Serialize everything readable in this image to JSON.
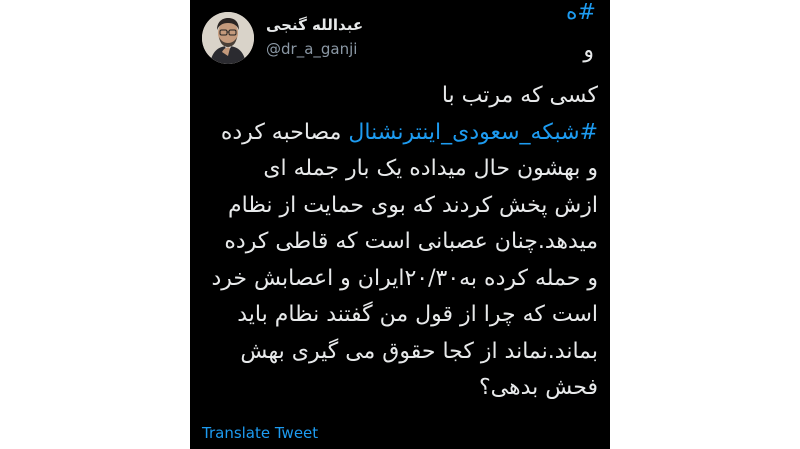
{
  "colors": {
    "background": "#000000",
    "text": "#e7e9ea",
    "link": "#1d9bf0",
    "muted": "#8b98a5",
    "page": "#ffffff"
  },
  "header": {
    "hashtag": "#ه",
    "conjunction": "و"
  },
  "author": {
    "display_name": "عبدالله گنجی",
    "handle": "@dr_a_ganji",
    "avatar_icon": "profile-photo"
  },
  "tweet": {
    "line_1": "کسی که مرتب با",
    "line_2_hashtag": "#شبکه_سعودی_اینترنشنال",
    "line_2_rest": " مصاحبه کرده",
    "line_3": "و بهشون حال میداده یک بار جمله ای",
    "line_4": "ازش پخش کردند که بوی حمایت از نظام",
    "line_5": "میدهد.چنان عصبانی است که قاطی کرده",
    "line_6": "و حمله کرده به۲۰/۳۰ایران و اعصابش خرد",
    "line_7": "است که چرا از قول من گفتند نظام باید",
    "line_8": "بماند.نماند از کجا حقوق می گیری بهش",
    "line_9": "فحش بدهی؟"
  },
  "actions": {
    "translate_label": "Translate Tweet"
  }
}
